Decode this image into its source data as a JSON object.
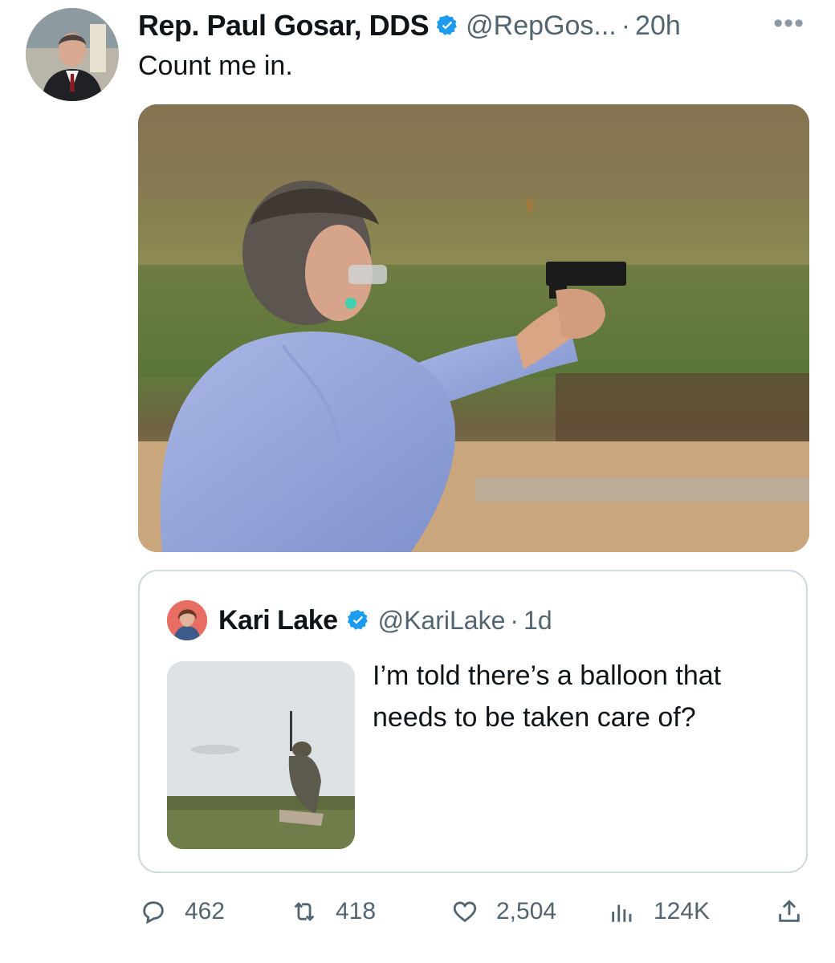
{
  "tweet": {
    "author_name": "Rep. Paul Gosar, DDS",
    "handle": "@RepGos...",
    "separator": "·",
    "time": "20h",
    "more_icon": "more-horizontal-icon",
    "text": "Count me in.",
    "media_description_icon": "photo-icon"
  },
  "quoted_tweet": {
    "author_name": "Kari Lake",
    "handle": "@KariLake",
    "separator": "·",
    "time": "1d",
    "text": "I’m told there’s a balloon that needs to be taken care of?"
  },
  "actions": {
    "reply_count": "462",
    "retweet_count": "418",
    "like_count": "2,504",
    "views_count": "124K"
  },
  "colors": {
    "verified": "#1d9bf0",
    "muted": "#536471",
    "border": "#cfd9de"
  }
}
